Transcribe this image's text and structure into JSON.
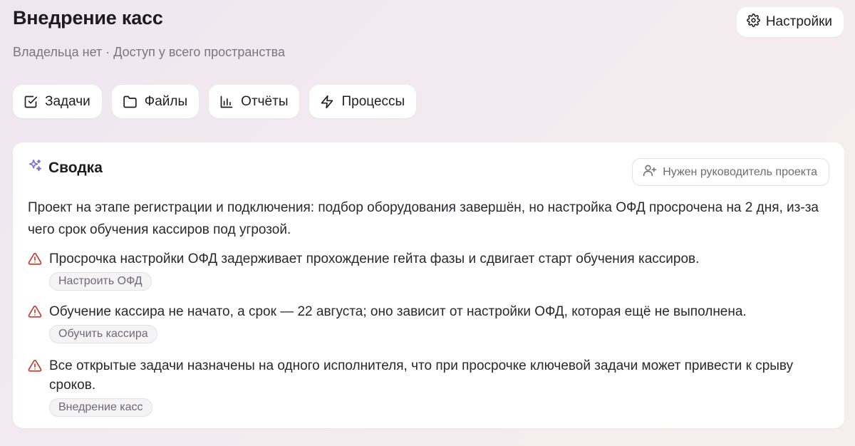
{
  "project": {
    "title": "Внедрение касс",
    "subtitle": "Владельца нет · Доступ у всего пространства"
  },
  "header": {
    "settings_label": "Настройки"
  },
  "tabs": [
    {
      "label": "Задачи",
      "icon": "checkbox-icon"
    },
    {
      "label": "Файлы",
      "icon": "folder-icon"
    },
    {
      "label": "Отчёты",
      "icon": "bar-chart-icon"
    },
    {
      "label": "Процессы",
      "icon": "lightning-icon"
    }
  ],
  "summary_card": {
    "title": "Сводка",
    "lead_button_label": "Нужен руководитель проекта",
    "text": "Проект на этапе регистрации и подключения: подбор оборудования завершён, но настройка ОФД просрочена на 2 дня, из-за чего срок обучения кассиров под угрозой.",
    "issues": [
      {
        "text": "Просрочка настройки ОФД задерживает прохождение гейта фазы и сдвигает старт обучения кассиров.",
        "chip": "Настроить ОФД"
      },
      {
        "text": "Обучение кассира не начато, а срок — 22 августа; оно зависит от настройки ОФД, которая ещё не выполнена.",
        "chip": "Обучить кассира"
      },
      {
        "text": "Все открытые задачи назначены на одного исполнителя, что при просрочке ключевой задачи может привести к срыву сроков.",
        "chip": "Внедрение касс"
      }
    ]
  },
  "colors": {
    "accent": "#7b6fd6",
    "warning": "#c0392b"
  }
}
